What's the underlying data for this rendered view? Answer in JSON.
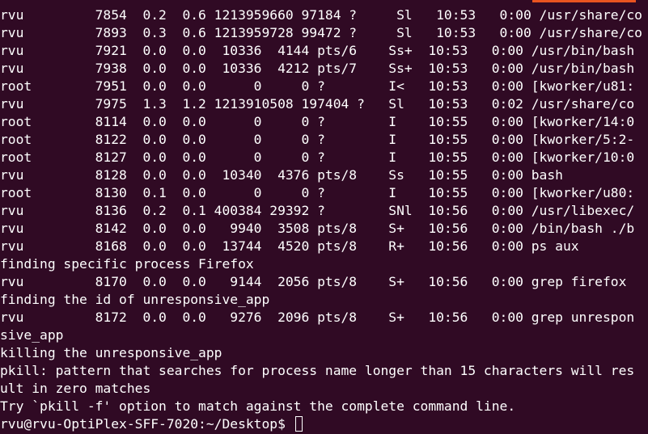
{
  "terminal": {
    "accent_color": "#e95420",
    "background_color": "#300a24",
    "text_color": "#ffffff",
    "lines": [
      "rvu         7854  0.2  0.6 1213959660 97184 ?     Sl   10:53   0:00 /usr/share/co",
      "rvu         7893  0.3  0.6 1213959728 99472 ?     Sl   10:53   0:00 /usr/share/co",
      "rvu         7921  0.0  0.0  10336  4144 pts/6    Ss+  10:53   0:00 /usr/bin/bash",
      "rvu         7938  0.0  0.0  10336  4212 pts/7    Ss+  10:53   0:00 /usr/bin/bash",
      "root        7951  0.0  0.0      0     0 ?        I<   10:53   0:00 [kworker/u81:",
      "rvu         7975  1.3  1.2 1213910508 197404 ?   Sl   10:53   0:02 /usr/share/co",
      "root        8114  0.0  0.0      0     0 ?        I    10:55   0:00 [kworker/14:0",
      "root        8122  0.0  0.0      0     0 ?        I    10:55   0:00 [kworker/5:2-",
      "root        8127  0.0  0.0      0     0 ?        I    10:55   0:00 [kworker/10:0",
      "rvu         8128  0.0  0.0  10340  4376 pts/8    Ss   10:55   0:00 bash",
      "root        8130  0.1  0.0      0     0 ?        I    10:55   0:00 [kworker/u80:",
      "rvu         8136  0.2  0.1 400384 29392 ?        SNl  10:56   0:00 /usr/libexec/",
      "rvu         8142  0.0  0.0   9940  3508 pts/8    S+   10:56   0:00 /bin/bash ./b",
      "rvu         8168  0.0  0.0  13744  4520 pts/8    R+   10:56   0:00 ps aux",
      "finding specific process Firefox",
      "rvu         8170  0.0  0.0   9144  2056 pts/8    S+   10:56   0:00 grep firefox",
      "finding the id of unresponsive_app",
      "rvu         8172  0.0  0.0   9276  2096 pts/8    S+   10:56   0:00 grep unrespon",
      "sive_app",
      "killing the unresponsive_app",
      "pkill: pattern that searches for process name longer than 15 characters will res",
      "ult in zero matches",
      "Try `pkill -f' option to match against the complete command line."
    ],
    "prompt": "rvu@rvu-OptiPlex-SFF-7020:~/Desktop$ "
  }
}
